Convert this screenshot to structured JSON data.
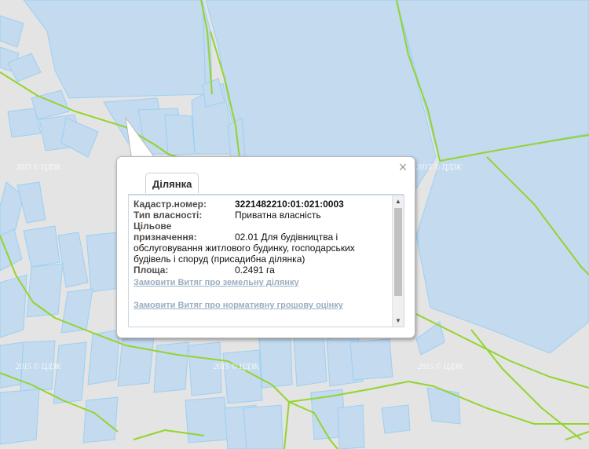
{
  "map": {
    "watermark": "2015 © ЦДЗК",
    "colors": {
      "background": "#e4e4e4",
      "parcel_fill": "#c3daef",
      "parcel_stroke": "#9dd0f2",
      "boundary_line": "#93d42f"
    }
  },
  "popup": {
    "tab_label": "Ділянка",
    "fields": {
      "cadastral_label": "Кадастр.номер:",
      "cadastral_value": "3221482210:01:021:0003",
      "ownership_label": "Тип власності:",
      "ownership_value": "Приватна власність",
      "purpose_label": "Цільове призначення:",
      "purpose_value": "02.01 Для будівництва і обслуговування житлового будинку, господарських будівель і споруд (присадибна ділянка)",
      "area_label": "Площа:",
      "area_value": "0.2491 га"
    },
    "links": {
      "extract_land": "Замовити Витяг про земельну ділянку",
      "extract_valuation": "Замовити Витяг про нормативну грошову оцінку"
    },
    "icons": {
      "close": "close-icon",
      "scroll_up": "arrow-up-icon",
      "scroll_down": "arrow-down-icon"
    }
  }
}
